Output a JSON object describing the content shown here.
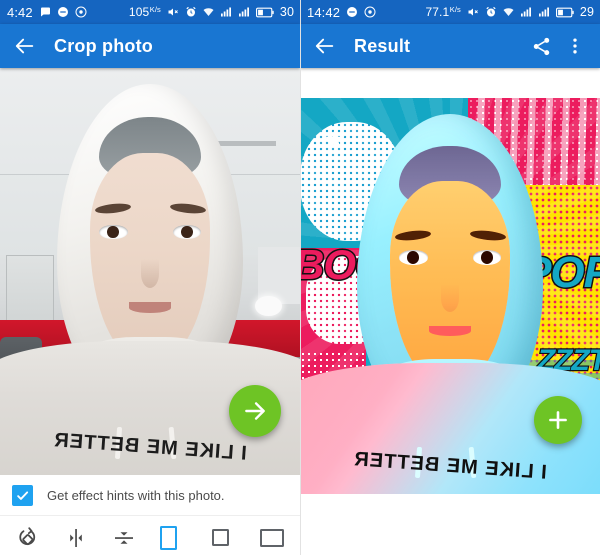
{
  "left_panel": {
    "statusbar": {
      "clock": "4:42",
      "net_speed": "105",
      "net_speed_unit": "K/s",
      "battery_level": "30",
      "icons": [
        "message-icon",
        "do-not-disturb-icon",
        "record-icon",
        "mute-icon",
        "alarm-icon",
        "wifi-icon",
        "signal-icon",
        "signal-icon",
        "battery-icon"
      ]
    },
    "appbar": {
      "back_label": "back-arrow",
      "title": "Crop photo"
    },
    "photo": {
      "alt": "Original selfie of a woman wearing a white hijab and a light hoodie",
      "shirt_text": "I LIKE ME BETTER"
    },
    "fab": {
      "label": "next-arrow"
    },
    "hint": {
      "checked": true,
      "label": "Get effect hints with this photo."
    },
    "toolbar": {
      "tools": [
        {
          "name": "rotate-tool",
          "label": "Rotate"
        },
        {
          "name": "flip-horizontal-tool",
          "label": "Flip horizontal"
        },
        {
          "name": "flip-vertical-tool",
          "label": "Flip vertical"
        }
      ],
      "ratios": [
        {
          "name": "ratio-portrait",
          "label": "Portrait",
          "selected": true
        },
        {
          "name": "ratio-square",
          "label": "Square",
          "selected": false
        },
        {
          "name": "ratio-landscape",
          "label": "Landscape",
          "selected": false
        }
      ]
    }
  },
  "right_panel": {
    "statusbar": {
      "clock": "14:42",
      "net_speed": "77.1",
      "net_speed_unit": "K/s",
      "battery_level": "29",
      "icons": [
        "do-not-disturb-icon",
        "record-icon",
        "mute-icon",
        "alarm-icon",
        "wifi-icon",
        "signal-icon",
        "signal-icon",
        "battery-icon"
      ]
    },
    "appbar": {
      "back_label": "back-arrow",
      "title": "Result",
      "share_label": "share",
      "overflow_label": "more-options"
    },
    "photo": {
      "alt": "Pop-art comic styled version of the selfie",
      "shirt_text": "I LIKE ME BETTER",
      "comic_words": [
        "BOOM",
        "POP",
        "ZZZT"
      ]
    },
    "fab": {
      "label": "add"
    }
  },
  "colors": {
    "statusbar_blue": "#1565c0",
    "appbar_blue": "#1976d2",
    "fab_green": "#6ec425",
    "checkbox_blue": "#1fa2f0",
    "accent_selected": "#1fa2f0",
    "comic_cyan": "#14a7c4",
    "comic_magenta": "#ec1c5e",
    "comic_yellow": "#ffe400"
  }
}
